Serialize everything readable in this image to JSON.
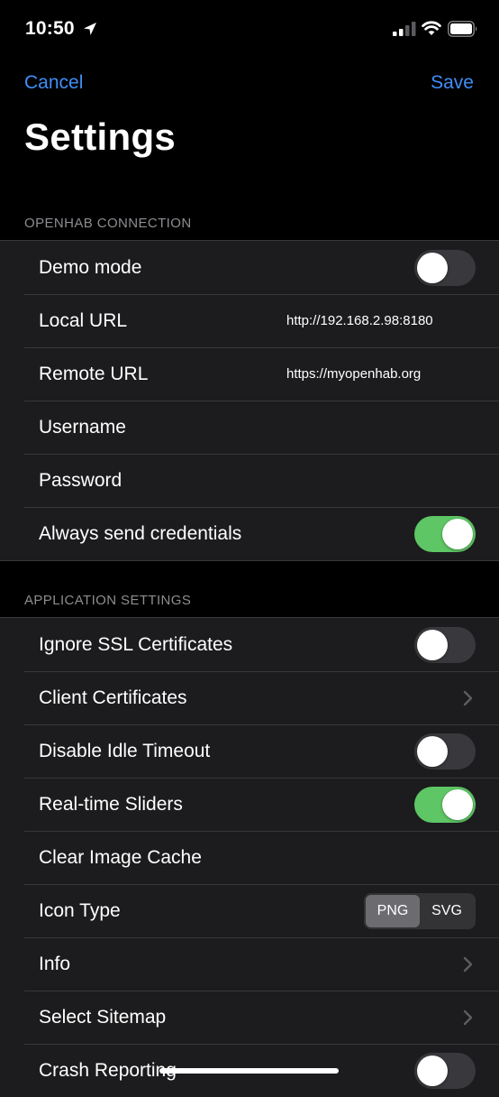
{
  "status_bar": {
    "time": "10:50",
    "icons": [
      "location-arrow-icon",
      "cellular-signal-icon",
      "wifi-icon",
      "battery-icon"
    ]
  },
  "nav": {
    "cancel_label": "Cancel",
    "save_label": "Save"
  },
  "title": "Settings",
  "sections": {
    "connection": {
      "header": "OPENHAB CONNECTION",
      "demo_mode": {
        "label": "Demo mode",
        "on": false
      },
      "local_url": {
        "label": "Local URL",
        "value": "http://192.168.2.98:8180"
      },
      "remote_url": {
        "label": "Remote URL",
        "value": "https://myopenhab.org"
      },
      "username": {
        "label": "Username",
        "value": ""
      },
      "password": {
        "label": "Password",
        "value": ""
      },
      "always_send_credentials": {
        "label": "Always send credentials",
        "on": true
      }
    },
    "application": {
      "header": "APPLICATION SETTINGS",
      "ignore_ssl": {
        "label": "Ignore SSL Certificates",
        "on": false
      },
      "client_certificates": {
        "label": "Client Certificates"
      },
      "disable_idle_timeout": {
        "label": "Disable Idle Timeout",
        "on": false
      },
      "realtime_sliders": {
        "label": "Real-time Sliders",
        "on": true
      },
      "clear_image_cache": {
        "label": "Clear Image Cache"
      },
      "icon_type": {
        "label": "Icon Type",
        "options": [
          "PNG",
          "SVG"
        ],
        "selected": "PNG"
      },
      "info": {
        "label": "Info"
      },
      "select_sitemap": {
        "label": "Select Sitemap"
      },
      "crash_reporting": {
        "label": "Crash Reporting",
        "on": false
      }
    }
  },
  "colors": {
    "accent": "#3f8ef8",
    "toggle_on": "#5ec664",
    "toggle_off": "#39393d",
    "cell_background": "#1c1c1e",
    "background": "#000000",
    "section_header": "#8d8d92"
  }
}
